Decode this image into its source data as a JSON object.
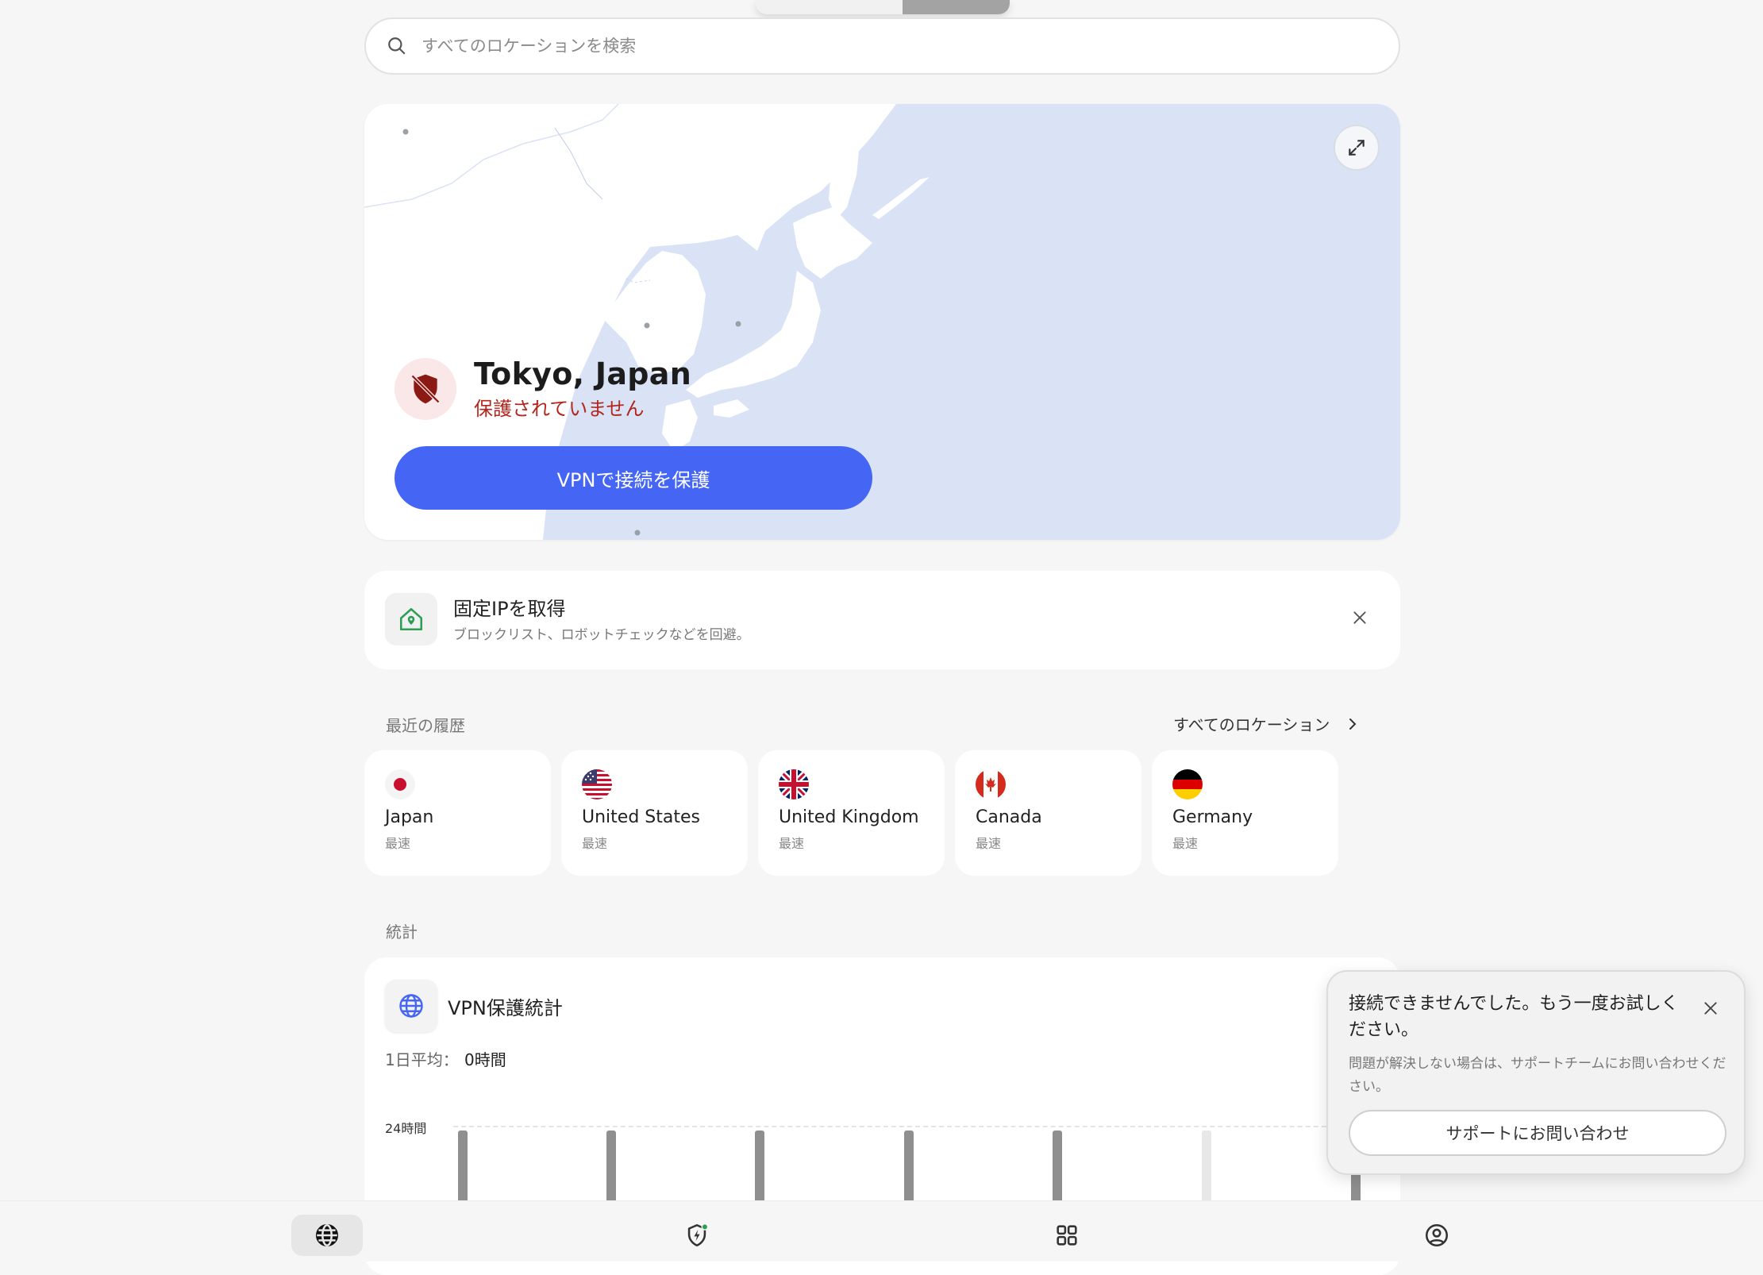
{
  "search": {
    "placeholder": "すべてのロケーションを検索"
  },
  "map": {
    "location": "Tokyo, Japan",
    "status": "保護されていません",
    "connect_label": "VPNで接続を保護",
    "colors": {
      "water": "#d9e3f5",
      "land": "#ffffff",
      "status": "#b3261e",
      "button": "#4566f4"
    }
  },
  "promo": {
    "title": "固定IPを取得",
    "subtitle": "ブロックリスト、ロボットチェックなどを回避。"
  },
  "recent": {
    "label": "最近の履歴",
    "all_label": "すべてのロケーション",
    "items": [
      {
        "country": "Japan",
        "tag": "最速",
        "flag": "japan-flag-icon"
      },
      {
        "country": "United States",
        "tag": "最速",
        "flag": "us-flag-icon"
      },
      {
        "country": "United Kingdom",
        "tag": "最速",
        "flag": "uk-flag-icon"
      },
      {
        "country": "Canada",
        "tag": "最速",
        "flag": "canada-flag-icon"
      },
      {
        "country": "Germany",
        "tag": "最速",
        "flag": "germany-flag-icon"
      }
    ]
  },
  "stats": {
    "label": "統計",
    "title": "VPN保護統計",
    "avg_label": "1日平均：",
    "avg_value": "0時間",
    "y_label": "24時間"
  },
  "toast": {
    "title": "接続できませんでした。もう一度お試しください。",
    "body": "問題が解決しない場合は、サポートチームにお問い合わせください。",
    "button": "サポートにお問い合わせ"
  },
  "nav": {
    "items": [
      {
        "icon": "globe-icon",
        "active": true
      },
      {
        "icon": "shield-bolt-icon",
        "active": false
      },
      {
        "icon": "grid-icon",
        "active": false
      },
      {
        "icon": "account-icon",
        "active": false
      }
    ]
  }
}
